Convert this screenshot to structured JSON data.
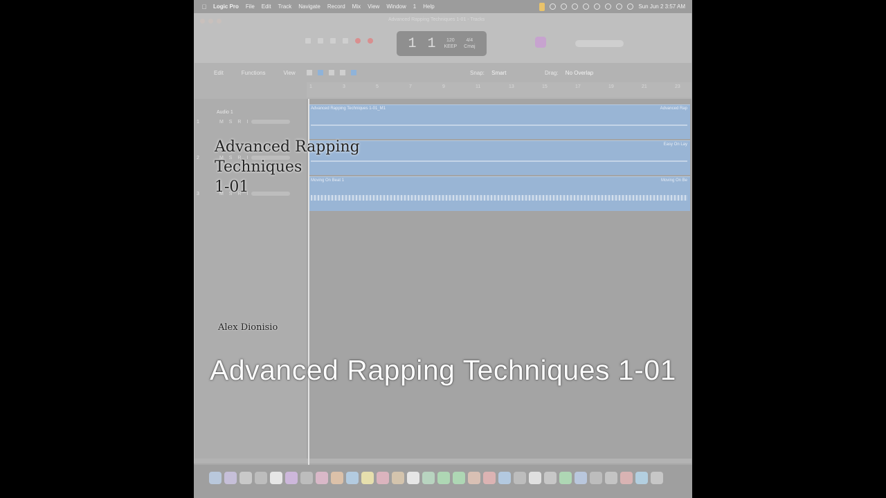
{
  "menubar": {
    "app_name": "Logic Pro",
    "items": [
      "File",
      "Edit",
      "Track",
      "Navigate",
      "Record",
      "Mix",
      "View",
      "Window",
      "1",
      "Help"
    ],
    "clock": "Sun Jun 2  3:57 AM"
  },
  "window": {
    "title": "Advanced Rapping Techniques 1-01 - Tracks",
    "lcd_position": "1 1",
    "lcd_tempo": "120",
    "lcd_tempo_label": "KEEP",
    "lcd_signature": "4/4",
    "lcd_key": "Cmaj"
  },
  "toolbar": {
    "edit_label": "Edit",
    "functions_label": "Functions",
    "view_label": "View",
    "snap_label": "Snap:",
    "snap_value": "Smart",
    "drag_label": "Drag:",
    "drag_value": "No Overlap"
  },
  "ruler": {
    "ticks": [
      "1",
      "3",
      "5",
      "7",
      "9",
      "11",
      "13",
      "15",
      "17",
      "19",
      "21",
      "23"
    ]
  },
  "tracks": [
    {
      "number": "1",
      "name": "Audio 1",
      "msri": "M S R I"
    },
    {
      "number": "2",
      "name": "",
      "msri": "M S R I"
    },
    {
      "number": "3",
      "name": "",
      "msri": "M S R I"
    }
  ],
  "regions": [
    {
      "name": "Advanced Rapping Techniques 1-01_M1",
      "name_right": "Advanced Rap"
    },
    {
      "name": "",
      "name_right": "Easy On Lay"
    },
    {
      "name": "Moving On Beat 1",
      "name_right": "Moving On Be"
    }
  ],
  "overlay": {
    "title_lines": [
      "Advanced Rapping",
      "Techniques",
      "1-01"
    ],
    "author": "Alex Dionisio",
    "caption": "Advanced Rapping Techniques 1-01"
  },
  "colors": {
    "region_blue": "#99b5d5",
    "record_red": "#d98f8f",
    "badge_purple": "#c7a3cf"
  }
}
